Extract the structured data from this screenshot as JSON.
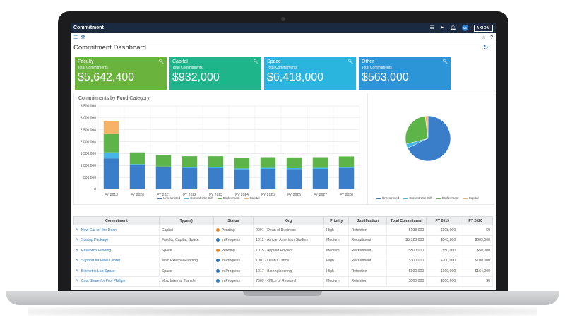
{
  "app": {
    "title": "Commitment",
    "brand": "AXIOM",
    "user_initials": "SC"
  },
  "page": {
    "title": "Commitment Dashboard"
  },
  "cards": [
    {
      "title": "Faculty",
      "subtitle": "Total Commitments",
      "value": "$5,642,400",
      "color": "#6ab43e"
    },
    {
      "title": "Capital",
      "subtitle": "Total Commitments",
      "value": "$932,000",
      "color": "#1fb58a"
    },
    {
      "title": "Space",
      "subtitle": "Total Commitments",
      "value": "$6,418,000",
      "color": "#2ab5df"
    },
    {
      "title": "Other",
      "subtitle": "Total Commitments",
      "value": "$563,000",
      "color": "#2b95d7"
    }
  ],
  "bar_panel": {
    "title": "Commitments by Fund Category"
  },
  "colors": {
    "unrestricted": "#3a7dc9",
    "current_use_gift": "#46b6e8",
    "endowment": "#5db549",
    "capital": "#f6b365"
  },
  "chart_data": [
    {
      "type": "bar",
      "stacked": true,
      "title": "Commitments by Fund Category",
      "categories": [
        "FY 2019",
        "FY 2020",
        "FY 2021",
        "FY 2022",
        "FY 2023",
        "FY 2024",
        "FY 2025",
        "FY 2026",
        "FY 2027",
        "FY 2028"
      ],
      "series": [
        {
          "name": "Unrestricted",
          "values": [
            1300000,
            1020000,
            920000,
            900000,
            890000,
            840000,
            860000,
            850000,
            860000,
            900000
          ]
        },
        {
          "name": "Current Use Gift",
          "values": [
            250000,
            40000,
            40000,
            40000,
            40000,
            40000,
            40000,
            40000,
            40000,
            40000
          ]
        },
        {
          "name": "Endowment",
          "values": [
            800000,
            490000,
            480000,
            450000,
            460000,
            450000,
            450000,
            450000,
            450000,
            440000
          ]
        },
        {
          "name": "Capital",
          "values": [
            500000,
            0,
            0,
            0,
            0,
            0,
            0,
            0,
            0,
            0
          ]
        }
      ],
      "ylim": [
        0,
        3500000
      ],
      "yticks": [
        "0",
        "500,000",
        "1,000,000",
        "1,500,000",
        "2,000,000",
        "2,500,000",
        "3,000,000",
        "3,500,000"
      ],
      "grid": true,
      "legend": "bottom"
    },
    {
      "type": "pie",
      "labels": [
        "Unrestricted",
        "Current Use Gift",
        "Endowment",
        "Capital"
      ],
      "values": [
        68,
        3,
        27,
        2
      ],
      "legend": "bottom"
    }
  ],
  "table": {
    "columns": [
      "Commitment",
      "Type(s)",
      "Status",
      "Org",
      "Priority",
      "Justification",
      "Total Commitment",
      "FY 2019",
      "FY 2020"
    ],
    "rows": [
      {
        "commitment": "New Car for the Dean",
        "types": "Capital",
        "status": "Pending",
        "status_color": "#f08a24",
        "org": "2001 - Dean of Business",
        "priority": "High",
        "justification": "Retention",
        "total": "$108,000",
        "fy2019": "$108,000",
        "fy2020": "$0"
      },
      {
        "commitment": "Startup Package",
        "types": "Faculty, Capital, Space",
        "status": "In Progress",
        "status_color": "#2a78c1",
        "org": "1012 - African American Studies",
        "priority": "Medium",
        "justification": "Recruitment",
        "total": "$5,323,000",
        "fy2019": "$543,800",
        "fy2020": "$609,000"
      },
      {
        "commitment": "Research Funding",
        "types": "Space",
        "status": "Pending",
        "status_color": "#f08a24",
        "org": "1015 - Applied Physics",
        "priority": "Medium",
        "justification": "Recruitment",
        "total": "$500,000",
        "fy2019": "$50,000",
        "fy2020": "$50,000"
      },
      {
        "commitment": "Support for Hillel Center",
        "types": "Misc External Funding",
        "status": "In Progress",
        "status_color": "#2a78c1",
        "org": "1001 - Dean's Office",
        "priority": "High",
        "justification": "Recruitment",
        "total": "$300,000",
        "fy2019": "$200,000",
        "fy2020": "$100,000"
      },
      {
        "commitment": "Biometric Lab Space",
        "types": "Space",
        "status": "In Progress",
        "status_color": "#2a78c1",
        "org": "1017 - Bioengineering",
        "priority": "High",
        "justification": "Retention",
        "total": "$300,000",
        "fy2019": "$100,000",
        "fy2020": "$164,000"
      },
      {
        "commitment": "Cost Share for Prof Phillips",
        "types": "Misc Internal Transfer",
        "status": "In Progress",
        "status_color": "#2a78c1",
        "org": "7009 - Office of Research",
        "priority": "Medium",
        "justification": "Retention",
        "total": "$300,000",
        "fy2019": "$100,000",
        "fy2020": "$0"
      }
    ]
  }
}
